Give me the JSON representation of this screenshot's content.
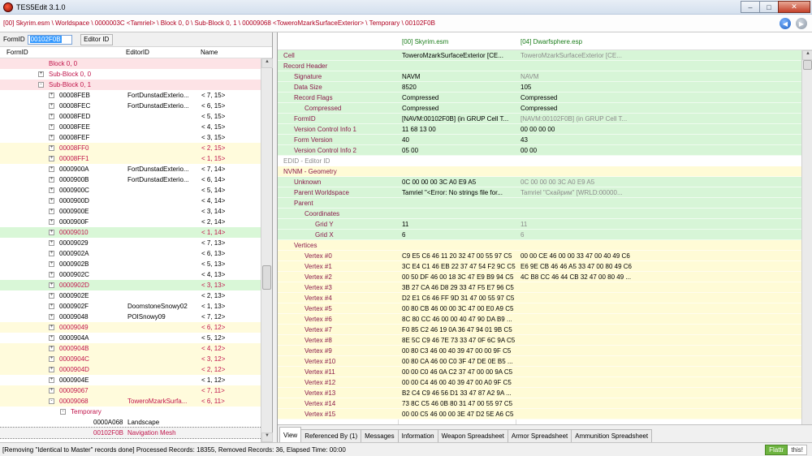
{
  "window": {
    "title": "TES5Edit 3.1.0",
    "buttons": {
      "minimize": "–",
      "maximize": "□",
      "close": "✕"
    }
  },
  "path": "[00] Skyrim.esm \\ Worldspace \\ 0000003C <Tamriel> \\ Block 0, 0 \\ Sub-Block 0, 1 \\ 00009068 <ToweroMzarkSurfaceExterior> \\ Temporary \\ 00102F0B",
  "filter": {
    "formid_label": "FormID",
    "formid_value": "00102F0B",
    "editorid_button": "Editor ID"
  },
  "tree": {
    "columns": [
      "FormID",
      "EditorID",
      "Name"
    ],
    "rows": [
      {
        "indent": 60,
        "pm": "",
        "formid": "Block 0, 0",
        "editorid": "",
        "name": "",
        "bg": "pink",
        "red": true
      },
      {
        "indent": 60,
        "pm": "+",
        "formid": "Sub-Block 0, 0",
        "editorid": "",
        "name": "",
        "bg": "",
        "red": true
      },
      {
        "indent": 60,
        "pm": "-",
        "formid": "Sub-Block 0, 1",
        "editorid": "",
        "name": "",
        "bg": "pink",
        "red": true
      },
      {
        "indent": 73,
        "pm": "+",
        "formid": "00008FEB",
        "editorid": "FortDunstadExterio...",
        "name": "< 7, 15>",
        "bg": "",
        "red": false
      },
      {
        "indent": 73,
        "pm": "+",
        "formid": "00008FEC",
        "editorid": "FortDunstadExterio...",
        "name": "< 6, 15>",
        "bg": "",
        "red": false
      },
      {
        "indent": 73,
        "pm": "+",
        "formid": "00008FED",
        "editorid": "",
        "name": "< 5, 15>",
        "bg": "",
        "red": false
      },
      {
        "indent": 73,
        "pm": "+",
        "formid": "00008FEE",
        "editorid": "",
        "name": "< 4, 15>",
        "bg": "",
        "red": false
      },
      {
        "indent": 73,
        "pm": "+",
        "formid": "00008FEF",
        "editorid": "",
        "name": "< 3, 15>",
        "bg": "",
        "red": false
      },
      {
        "indent": 73,
        "pm": "+",
        "formid": "00008FF0",
        "editorid": "",
        "name": "< 2, 15>",
        "bg": "yellow",
        "red": true
      },
      {
        "indent": 73,
        "pm": "+",
        "formid": "00008FF1",
        "editorid": "",
        "name": "< 1, 15>",
        "bg": "yellow",
        "red": true
      },
      {
        "indent": 73,
        "pm": "+",
        "formid": "0000900A",
        "editorid": "FortDunstadExterio...",
        "name": "< 7, 14>",
        "bg": "",
        "red": false
      },
      {
        "indent": 73,
        "pm": "+",
        "formid": "0000900B",
        "editorid": "FortDunstadExterio...",
        "name": "< 6, 14>",
        "bg": "",
        "red": false
      },
      {
        "indent": 73,
        "pm": "+",
        "formid": "0000900C",
        "editorid": "",
        "name": "< 5, 14>",
        "bg": "",
        "red": false
      },
      {
        "indent": 73,
        "pm": "+",
        "formid": "0000900D",
        "editorid": "",
        "name": "< 4, 14>",
        "bg": "",
        "red": false
      },
      {
        "indent": 73,
        "pm": "+",
        "formid": "0000900E",
        "editorid": "",
        "name": "< 3, 14>",
        "bg": "",
        "red": false
      },
      {
        "indent": 73,
        "pm": "+",
        "formid": "0000900F",
        "editorid": "",
        "name": "< 2, 14>",
        "bg": "",
        "red": false
      },
      {
        "indent": 73,
        "pm": "+",
        "formid": "00009010",
        "editorid": "",
        "name": "< 1, 14>",
        "bg": "green",
        "red": true
      },
      {
        "indent": 73,
        "pm": "+",
        "formid": "00009029",
        "editorid": "",
        "name": "< 7, 13>",
        "bg": "",
        "red": false
      },
      {
        "indent": 73,
        "pm": "+",
        "formid": "0000902A",
        "editorid": "",
        "name": "< 6, 13>",
        "bg": "",
        "red": false
      },
      {
        "indent": 73,
        "pm": "+",
        "formid": "0000902B",
        "editorid": "",
        "name": "< 5, 13>",
        "bg": "",
        "red": false
      },
      {
        "indent": 73,
        "pm": "+",
        "formid": "0000902C",
        "editorid": "",
        "name": "< 4, 13>",
        "bg": "",
        "red": false
      },
      {
        "indent": 73,
        "pm": "+",
        "formid": "0000902D",
        "editorid": "",
        "name": "< 3, 13>",
        "bg": "green",
        "red": true
      },
      {
        "indent": 73,
        "pm": "+",
        "formid": "0000902E",
        "editorid": "",
        "name": "< 2, 13>",
        "bg": "",
        "red": false
      },
      {
        "indent": 73,
        "pm": "+",
        "formid": "0000902F",
        "editorid": "DoomstoneSnowy02",
        "name": "< 1, 13>",
        "bg": "",
        "red": false
      },
      {
        "indent": 73,
        "pm": "+",
        "formid": "00009048",
        "editorid": "POISnowy09",
        "name": "< 7, 12>",
        "bg": "",
        "red": false
      },
      {
        "indent": 73,
        "pm": "+",
        "formid": "00009049",
        "editorid": "",
        "name": "< 6, 12>",
        "bg": "yellow",
        "red": true
      },
      {
        "indent": 73,
        "pm": "+",
        "formid": "0000904A",
        "editorid": "",
        "name": "< 5, 12>",
        "bg": "",
        "red": false
      },
      {
        "indent": 73,
        "pm": "+",
        "formid": "0000904B",
        "editorid": "",
        "name": "< 4, 12>",
        "bg": "yellow",
        "red": true
      },
      {
        "indent": 73,
        "pm": "+",
        "formid": "0000904C",
        "editorid": "",
        "name": "< 3, 12>",
        "bg": "yellow",
        "red": true
      },
      {
        "indent": 73,
        "pm": "+",
        "formid": "0000904D",
        "editorid": "",
        "name": "< 2, 12>",
        "bg": "yellow",
        "red": true
      },
      {
        "indent": 73,
        "pm": "+",
        "formid": "0000904E",
        "editorid": "",
        "name": "< 1, 12>",
        "bg": "",
        "red": false
      },
      {
        "indent": 73,
        "pm": "+",
        "formid": "00009067",
        "editorid": "",
        "name": "< 7, 11>",
        "bg": "yellow",
        "red": true
      },
      {
        "indent": 73,
        "pm": "-",
        "formid": "00009068",
        "editorid": "ToweroMzarkSurfa...",
        "name": "< 6, 11>",
        "bg": "yellow",
        "red": true
      },
      {
        "indent": 87,
        "pm": "-",
        "formid": "Temporary",
        "editorid": "",
        "name": "",
        "bg": "",
        "red": true
      },
      {
        "indent": 115,
        "pm": "",
        "formid": "0000A068",
        "editorid": "Landscape",
        "name": "",
        "bg": "",
        "red": false
      },
      {
        "indent": 115,
        "pm": "",
        "formid": "00102F0B",
        "editorid": "Navigation Mesh",
        "name": "",
        "bg": "sel",
        "red": true
      }
    ]
  },
  "record": {
    "headers": [
      "[00] Skyrim.esm",
      "[04] Dwarfsphere.esp"
    ],
    "rows": [
      {
        "lvl": 0,
        "label": "Cell",
        "v1": "ToweroMzarkSurfaceExterior [CE...",
        "v2": "ToweroMzarkSurfaceExterior [CE...",
        "bg": "g",
        "v2grey": true
      },
      {
        "lvl": 0,
        "label": "Record Header",
        "v1": "",
        "v2": "",
        "bg": "g",
        "v2grey": false
      },
      {
        "lvl": 1,
        "label": "Signature",
        "v1": "NAVM",
        "v2": "NAVM",
        "bg": "g",
        "v2grey": true
      },
      {
        "lvl": 1,
        "label": "Data Size",
        "v1": "8520",
        "v2": "105",
        "bg": "g",
        "v2grey": false
      },
      {
        "lvl": 1,
        "label": "Record Flags",
        "v1": "Compressed",
        "v2": "Compressed",
        "bg": "g",
        "v2grey": false
      },
      {
        "lvl": 2,
        "label": "Compressed",
        "v1": "Compressed",
        "v2": "Compressed",
        "bg": "g",
        "v2grey": false
      },
      {
        "lvl": 1,
        "label": "FormID",
        "v1": "[NAVM:00102F0B] (in GRUP Cell T...",
        "v2": "[NAVM:00102F0B] (in GRUP Cell T...",
        "bg": "g",
        "v2grey": true
      },
      {
        "lvl": 1,
        "label": "Version Control Info 1",
        "v1": "11 68 13 00",
        "v2": "00 00 00 00",
        "bg": "g",
        "v2grey": false
      },
      {
        "lvl": 1,
        "label": "Form Version",
        "v1": "40",
        "v2": "43",
        "bg": "g",
        "v2grey": false
      },
      {
        "lvl": 1,
        "label": "Version Control Info 2",
        "v1": "05 00",
        "v2": "00 00",
        "bg": "g",
        "v2grey": false
      },
      {
        "lvl": 0,
        "label": "EDID - Editor ID",
        "v1": "",
        "v2": "",
        "bg": "w",
        "v2grey": false,
        "grey": true
      },
      {
        "lvl": 0,
        "label": "NVNM - Geometry",
        "v1": "",
        "v2": "",
        "bg": "y",
        "v2grey": false
      },
      {
        "lvl": 1,
        "label": "Unknown",
        "v1": "0C 00 00 00 3C A0 E9 A5",
        "v2": "0C 00 00 00 3C A0 E9 A5",
        "bg": "g",
        "v2grey": true
      },
      {
        "lvl": 1,
        "label": "Parent Worldspace",
        "v1": "Tamriel \"<Error: No strings file for...",
        "v2": "Tamriel \"Скайрим\" [WRLD:00000...",
        "bg": "g",
        "v2grey": true
      },
      {
        "lvl": 1,
        "label": "Parent",
        "v1": "",
        "v2": "",
        "bg": "g",
        "v2grey": false
      },
      {
        "lvl": 2,
        "label": "Coordinates",
        "v1": "",
        "v2": "",
        "bg": "g",
        "v2grey": false
      },
      {
        "lvl": 3,
        "label": "Grid Y",
        "v1": "11",
        "v2": "11",
        "bg": "g",
        "v2grey": true
      },
      {
        "lvl": 3,
        "label": "Grid X",
        "v1": "6",
        "v2": "6",
        "bg": "g",
        "v2grey": true
      },
      {
        "lvl": 1,
        "label": "Vertices",
        "v1": "",
        "v2": "",
        "bg": "y",
        "v2grey": false
      },
      {
        "lvl": 2,
        "label": "Vertex #0",
        "v1": "C9 E5 C6 46 11 20 32 47 00 55 97 C5",
        "v2": "00 00 CE 46 00 00 33 47 00 40 49 C6",
        "bg": "y",
        "v2grey": false
      },
      {
        "lvl": 2,
        "label": "Vertex #1",
        "v1": "3C E4 C1 46 EB 22 37 47 54 F2 9C C5",
        "v2": "E6 9E CB 46 46 A5 33 47 00 80 49 C6",
        "bg": "y",
        "v2grey": false
      },
      {
        "lvl": 2,
        "label": "Vertex #2",
        "v1": "00 50 DF 46 00 18 3C 47 E9 B9 94 C5",
        "v2": "4C B8 CC 46 44 CB 32 47 00 80 49 ...",
        "bg": "y",
        "v2grey": false
      },
      {
        "lvl": 2,
        "label": "Vertex #3",
        "v1": "3B 27 CA 46 D8 29 33 47 F5 E7 96 C5",
        "v2": "",
        "bg": "y",
        "v2grey": false
      },
      {
        "lvl": 2,
        "label": "Vertex #4",
        "v1": "D2 E1 C6 46 FF 9D 31 47 00 55 97 C5",
        "v2": "",
        "bg": "y",
        "v2grey": false
      },
      {
        "lvl": 2,
        "label": "Vertex #5",
        "v1": "00 80 CB 46 00 00 3C 47 00 E0 A9 C5",
        "v2": "",
        "bg": "y",
        "v2grey": false
      },
      {
        "lvl": 2,
        "label": "Vertex #6",
        "v1": "8C 80 CC 46 00 00 40 47 90 DA B9 ...",
        "v2": "",
        "bg": "y",
        "v2grey": false
      },
      {
        "lvl": 2,
        "label": "Vertex #7",
        "v1": "F0 85 C2 46 19 0A 36 47 94 01 9B C5",
        "v2": "",
        "bg": "y",
        "v2grey": false
      },
      {
        "lvl": 2,
        "label": "Vertex #8",
        "v1": "8E 5C C9 46 7E 73 33 47 0F 6C 9A C5",
        "v2": "",
        "bg": "y",
        "v2grey": false
      },
      {
        "lvl": 2,
        "label": "Vertex #9",
        "v1": "00 80 C3 46 00 40 39 47 00 00 9F C5",
        "v2": "",
        "bg": "y",
        "v2grey": false
      },
      {
        "lvl": 2,
        "label": "Vertex #10",
        "v1": "00 80 CA 46 00 C0 3F 47 DE 0E B5 ...",
        "v2": "",
        "bg": "y",
        "v2grey": false
      },
      {
        "lvl": 2,
        "label": "Vertex #11",
        "v1": "00 00 C0 46 0A C2 37 47 00 00 9A C5",
        "v2": "",
        "bg": "y",
        "v2grey": false
      },
      {
        "lvl": 2,
        "label": "Vertex #12",
        "v1": "00 00 C4 46 00 40 39 47 00 A0 9F C5",
        "v2": "",
        "bg": "y",
        "v2grey": false
      },
      {
        "lvl": 2,
        "label": "Vertex #13",
        "v1": "B2 C4 C9 46 56 D1 33 47 87 A2 9A ...",
        "v2": "",
        "bg": "y",
        "v2grey": false
      },
      {
        "lvl": 2,
        "label": "Vertex #14",
        "v1": "73 8C C5 46 0B 80 31 47 00 55 97 C5",
        "v2": "",
        "bg": "y",
        "v2grey": false
      },
      {
        "lvl": 2,
        "label": "Vertex #15",
        "v1": "00 00 C5 46 00 00 3E 47 D2 5E A6 C5",
        "v2": "",
        "bg": "y",
        "v2grey": false
      }
    ]
  },
  "tabs": [
    "View",
    "Referenced By (1)",
    "Messages",
    "Information",
    "Weapon Spreadsheet",
    "Armor Spreadsheet",
    "Ammunition Spreadsheet"
  ],
  "status": {
    "text": "[Removing \"Identical to Master\" records done]  Processed Records: 18355, Removed Records: 36, Elapsed Time: 00:00",
    "flattr_a": "Flattr",
    "flattr_b": "this!"
  }
}
